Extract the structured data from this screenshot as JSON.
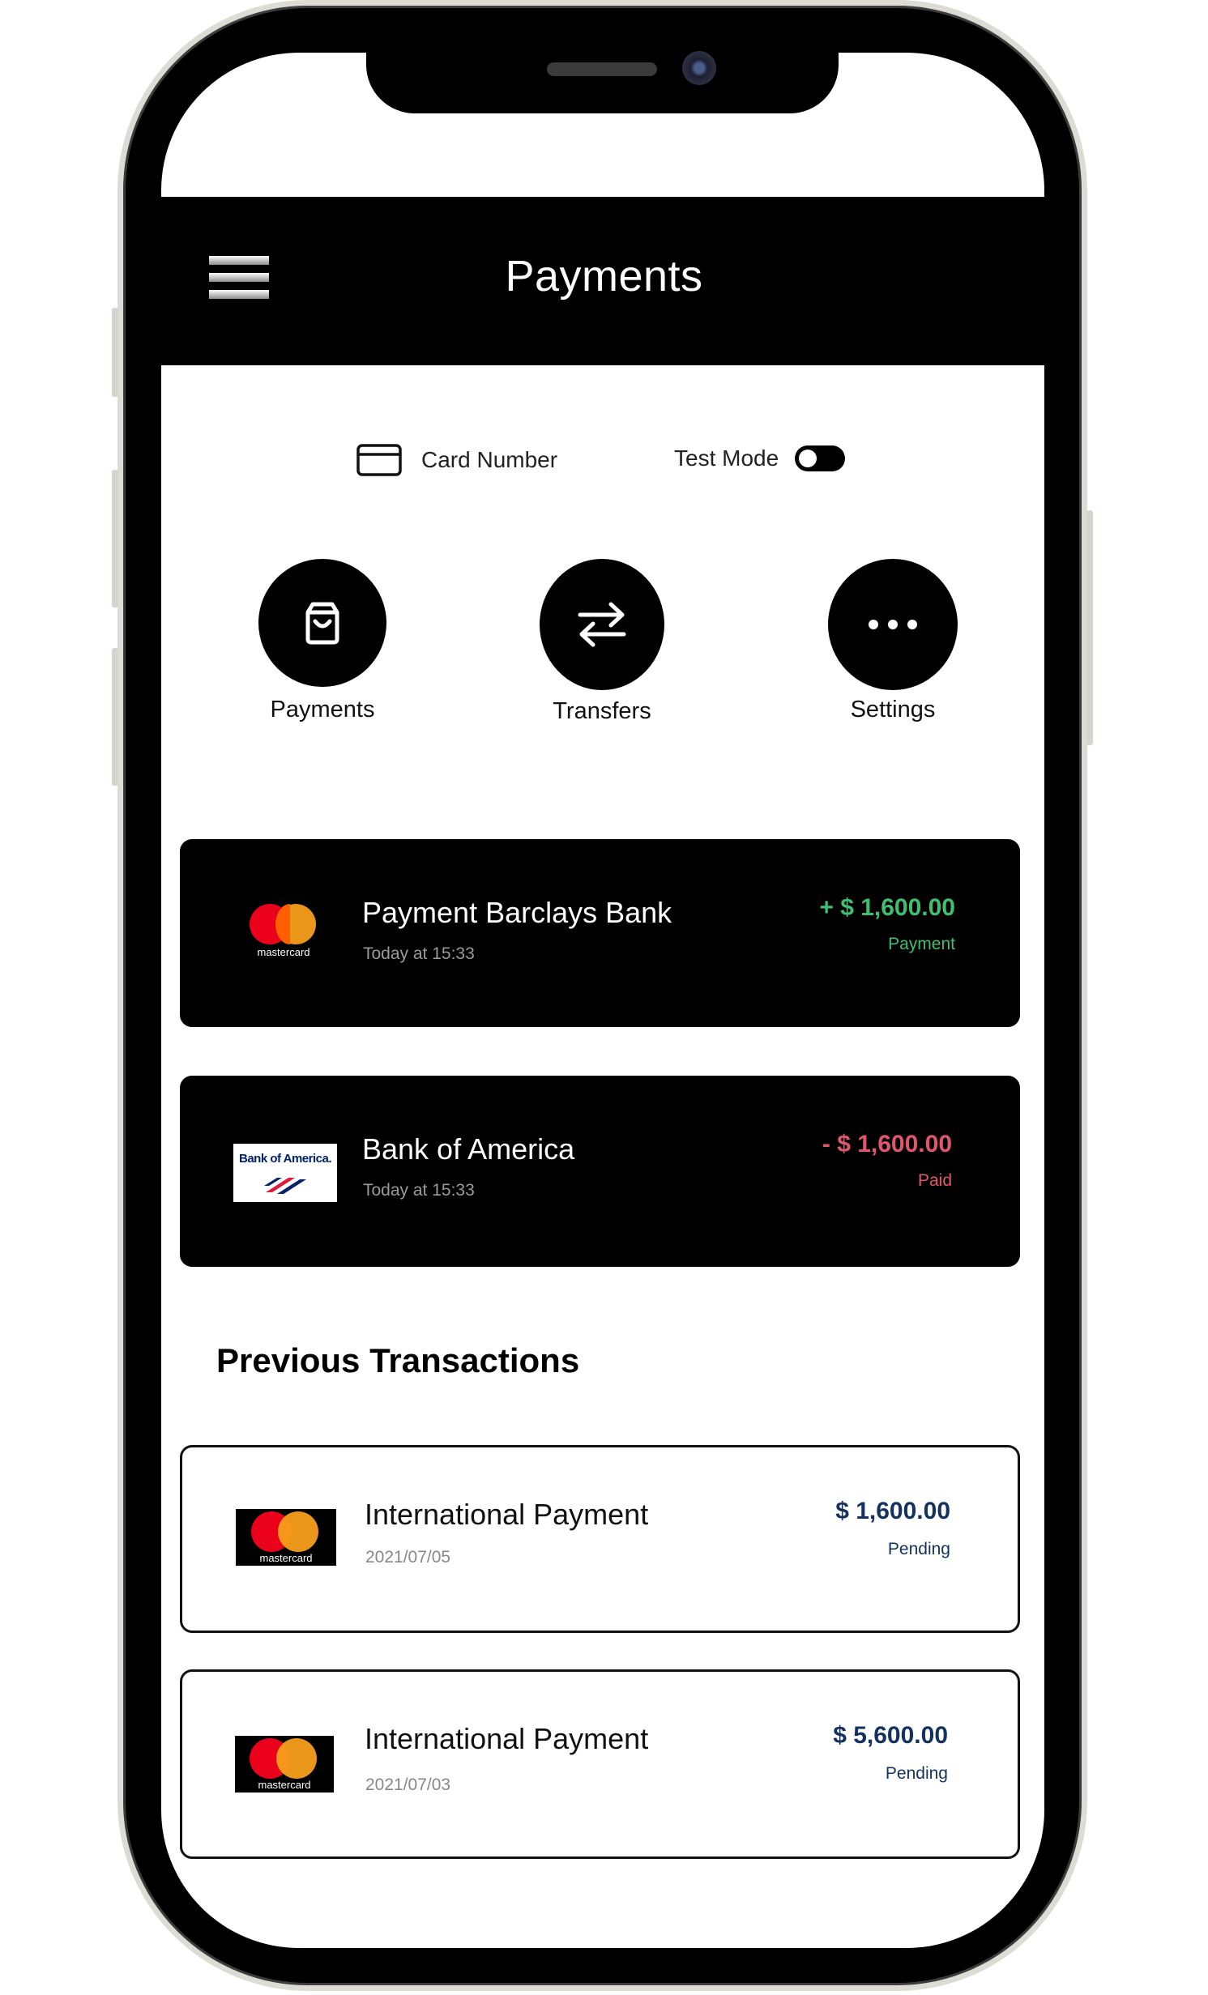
{
  "header": {
    "title": "Payments",
    "menu_icon": "hamburger-icon"
  },
  "controls": {
    "card_number_label": "Card Number",
    "card_icon": "credit-card-icon",
    "test_mode_label": "Test Mode",
    "test_mode_enabled": false
  },
  "actions": [
    {
      "label": "Payments",
      "icon": "shopping-bag-icon"
    },
    {
      "label": "Transfers",
      "icon": "transfer-arrows-icon"
    },
    {
      "label": "Settings",
      "icon": "more-dots-icon"
    }
  ],
  "recent": [
    {
      "title": "Payment Barclays Bank",
      "time": "Today at 15:33",
      "amount": "+ $ 1,600.00",
      "status": "Payment",
      "logo": "mastercard-logo",
      "logo_text": "mastercard",
      "color": "#3fbf6f"
    },
    {
      "title": "Bank of America",
      "time": "Today at 15:33",
      "amount": "- $ 1,600.00",
      "status": "Paid",
      "logo": "bank-of-america-logo",
      "logo_text": "Bank of America.",
      "color": "#e0566a"
    }
  ],
  "previous": {
    "heading": "Previous Transactions",
    "items": [
      {
        "title": "International Payment",
        "date": "2021/07/05",
        "amount": "$ 1,600.00",
        "status": "Pending",
        "logo": "mastercard-logo",
        "logo_text": "mastercard"
      },
      {
        "title": "International Payment",
        "date": "2021/07/03",
        "amount": "$ 5,600.00",
        "status": "Pending",
        "logo": "mastercard-logo",
        "logo_text": "mastercard"
      }
    ],
    "amount_color": "#14325f"
  },
  "colors": {
    "mastercard_red": "#eb001b",
    "mastercard_orange": "#f79e1b",
    "boa_blue": "#012169",
    "boa_red": "#e31837"
  }
}
